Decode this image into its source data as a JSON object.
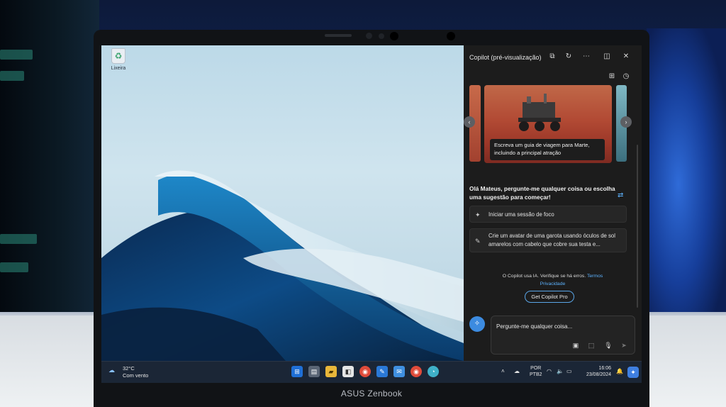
{
  "device": {
    "brand": "ASUS Zenbook"
  },
  "desktop": {
    "recycle_bin_label": "Lixeira"
  },
  "copilot": {
    "title": "Copilot (pré-visualização)",
    "carousel_card_text": "Escreva um guia de viagem para Marte, incluindo a principal atração",
    "greeting": "Olá Mateus, pergunte-me qualquer coisa ou escolha uma sugestão para começar!",
    "suggestions": [
      "Iniciar uma sessão de foco",
      "Crie um avatar de uma garota usando óculos de sol amarelos com cabelo que cobre sua testa e..."
    ],
    "disclaimer_text": "O Copilot usa IA. Verifique se há erros.",
    "terms_link": "Termos",
    "privacy_link": "Privacidade",
    "pro_button": "Get Copilot Pro",
    "input_placeholder": "Pergunte-me qualquer coisa..."
  },
  "taskbar": {
    "weather_temp": "32°C",
    "weather_desc": "Com vento",
    "lang_top": "POR",
    "lang_bottom": "PTB2",
    "time": "16:06",
    "date": "23/08/2024"
  },
  "colors": {
    "accent": "#5db3ff",
    "panel": "#1c1c1c",
    "taskbar": "#1b2636"
  },
  "icons": [
    "recycle-bin-icon",
    "external-link-icon",
    "refresh-icon",
    "more-icon",
    "dock-icon",
    "close-icon",
    "apps-icon",
    "history-icon",
    "chevron-left-icon",
    "chevron-right-icon",
    "sparkle-icon",
    "compose-icon",
    "image-icon",
    "screenshot-icon",
    "mic-icon",
    "send-icon",
    "weather-icon",
    "start-icon",
    "search-icon",
    "folder-icon",
    "store-icon",
    "chrome-icon",
    "mail-icon",
    "wifi-icon",
    "volume-icon",
    "battery-icon",
    "bell-icon"
  ]
}
